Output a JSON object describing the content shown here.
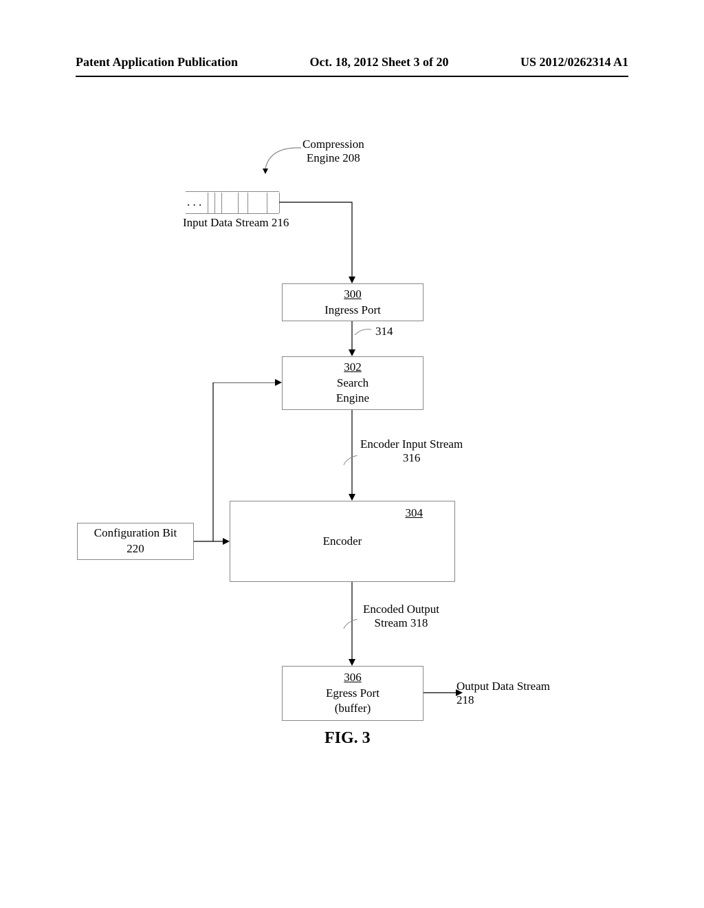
{
  "header": {
    "left": "Patent Application Publication",
    "mid": "Oct. 18, 2012  Sheet 3 of 20",
    "right": "US 2012/0262314 A1"
  },
  "labels": {
    "compression_engine": "Compression\nEngine 208",
    "input_stream": "Input Data Stream 216",
    "input_ellipsis": ". . .",
    "ingress_num": "300",
    "ingress": "Ingress Port",
    "ref_314": "314",
    "search_num": "302",
    "search_line1": "Search",
    "search_line2": "Engine",
    "encoder_input": "Encoder Input Stream\n316",
    "encoder_num": "304",
    "encoder": "Encoder",
    "config_line1": "Configuration Bit",
    "config_line2": "220",
    "encoded_output": "Encoded Output\nStream 318",
    "egress_num": "306",
    "egress_line1": "Egress Port",
    "egress_line2": "(buffer)",
    "output_stream": "Output Data Stream\n218",
    "figure": "FIG. 3"
  }
}
